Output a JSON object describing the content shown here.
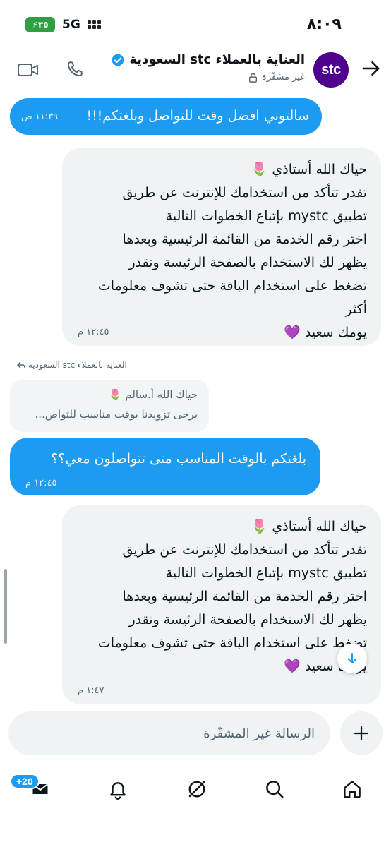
{
  "status_bar": {
    "time": "٨:٠٩",
    "network": "5G",
    "battery": "٣٥"
  },
  "header": {
    "contact_name": "العناية بالعملاء stc السعودية",
    "encryption_status": "غير مشفّرة",
    "avatar_text": "stc",
    "verified": true
  },
  "messages": [
    {
      "direction": "sent",
      "text": "سالتوني افضل وقت للتواصل وبلغتكم!!!",
      "time": "١١:٣٩ ص"
    },
    {
      "direction": "received",
      "text": "حياك الله أستاذي 🌷\n تقدر تتأكد من استخدامك للإنترنت عن طريق\nتطبيق mystc بإتباع الخطوات التالية\nاختر رقم الخدمة من القائمة الرئيسية وبعدها\nيظهر لك الاستخدام بالصفحة الرئيسة وتقدر\nتضغط على استخدام الباقة حتى تشوف معلومات\nأكثر\nيومك سعيد 💜",
      "time": "١٢:٤٥ م"
    },
    {
      "direction": "sent",
      "reply_to_label": "العناية بالعملاء stc السعودية",
      "quoted_line_1": "حياك الله أ.سالم 🌷",
      "quoted_line_2": "يرجى تزويدنا بوقت مناسب للتواص...",
      "text": "بلغتكم بالوقت المناسب متى تتواصلون معي؟؟",
      "time": "١٢:٤٥ م"
    },
    {
      "direction": "received",
      "text": "حياك الله أستاذي 🌷\n تقدر تتأكد من استخدامك للإنترنت عن طريق\nتطبيق mystc بإتباع الخطوات التالية\nاختر رقم الخدمة من القائمة الرئيسية وبعدها\nيظهر لك الاستخدام بالصفحة الرئيسة وتقدر\nتضغط على استخدام الباقة حتى تشوف معلومات\nيومك سعيد 💜",
      "time": "١:٤٧ م"
    }
  ],
  "composer": {
    "placeholder": "الرسالة غير المشفّرة"
  },
  "nav": {
    "messages_badge": "+20"
  },
  "colors": {
    "accent": "#1d9bf0",
    "received_bubble": "#eff3f4",
    "stc_purple": "#4f008c"
  }
}
